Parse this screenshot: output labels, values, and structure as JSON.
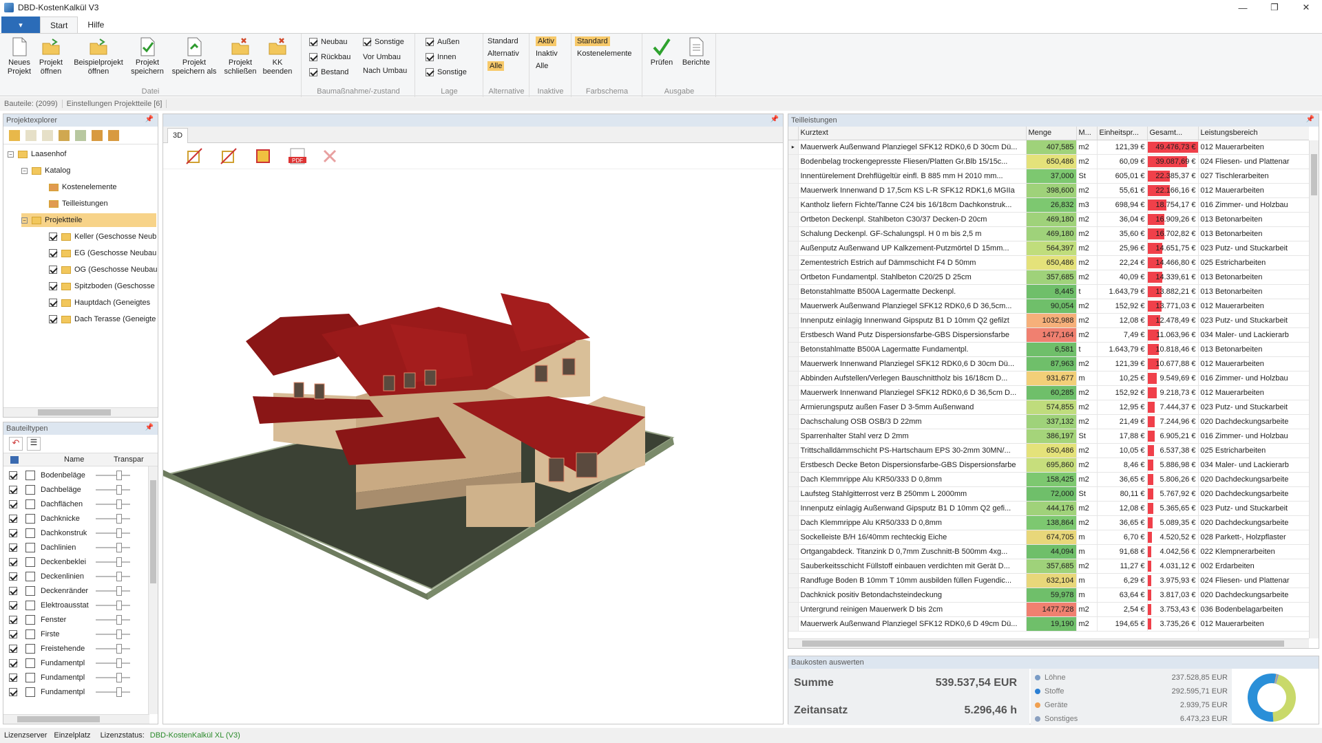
{
  "window": {
    "title": "DBD-KostenKalkül V3"
  },
  "ribbon": {
    "tabs": [
      "Start",
      "Hilfe"
    ],
    "datei": {
      "label": "Datei",
      "buttons": [
        "Neues Projekt",
        "Projekt öffnen",
        "Beispielprojekt öffnen",
        "Projekt speichern",
        "Projekt speichern als",
        "Projekt schließen",
        "KK beenden"
      ]
    },
    "bau": {
      "label": "Baumaßnahme/-zustand",
      "checks": [
        "Neubau",
        "Rückbau",
        "Bestand",
        "Sonstige"
      ],
      "opts": [
        "Vor Umbau",
        "Nach Umbau"
      ]
    },
    "lage": {
      "label": "Lage",
      "checks": [
        "Außen",
        "Innen",
        "Sonstige"
      ]
    },
    "alternative": {
      "label": "Alternative",
      "opts": [
        "Standard",
        "Alternativ",
        "Alle"
      ]
    },
    "inaktive": {
      "label": "Inaktive",
      "opts": [
        "Aktiv",
        "Inaktiv",
        "Alle"
      ]
    },
    "farbschema": {
      "label": "Farbschema",
      "opts": [
        "Standard",
        "Kostenelemente"
      ]
    },
    "ausgabe": {
      "label": "Ausgabe",
      "buttons": [
        "Prüfen",
        "Berichte"
      ]
    }
  },
  "statusbar_top": [
    "Bauteile: (2099)",
    "Einstellungen Projektteile [6]"
  ],
  "explorer": {
    "title": "Projektexplorer",
    "items": [
      "Laasenhof",
      "Katalog",
      "Kostenelemente",
      "Teilleistungen",
      "Projektteile",
      "Keller (Geschosse Neub",
      "EG (Geschosse Neubau",
      "OG (Geschosse Neubau",
      "Spitzboden (Geschosse",
      "Hauptdach (Geneigtes",
      "Dach Terasse (Geneigte"
    ]
  },
  "bauteiltypen": {
    "title": "Bauteiltypen",
    "cols": [
      "Name",
      "Transpar"
    ],
    "items": [
      "Bodenbeläge",
      "Dachbeläge",
      "Dachflächen",
      "Dachknicke",
      "Dachkonstruk",
      "Dachlinien",
      "Deckenbeklei",
      "Deckenlinien",
      "Deckenränder",
      "Elektroausstat",
      "Fenster",
      "Firste",
      "Freistehende",
      "Fundamentpl",
      "Fundamentpl",
      "Fundamentpl"
    ]
  },
  "viewer": {
    "tab": "3D"
  },
  "teilleistungen": {
    "title": "Teilleistungen",
    "cols": [
      "Kurztext",
      "Menge",
      "M...",
      "Einheitspr...",
      "Gesamt...",
      "Leistungsbereich"
    ],
    "rows": [
      [
        "Mauerwerk Außenwand Planziegel SFK12 RDK0,6 D 30cm Dü...",
        "407,585",
        "m2",
        "121,39 €",
        "49.476,73 €",
        "012 Mauerarbeiten"
      ],
      [
        "Bodenbelag trockengepresste Fliesen/Platten Gr.Blb 15/15c...",
        "650,486",
        "m2",
        "60,09 €",
        "39.087,69 €",
        "024 Fliesen- und Plattenar"
      ],
      [
        "Innentürelement Drehflügeltür einfl. B 885 mm H 2010 mm...",
        "37,000",
        "St",
        "605,01 €",
        "22.385,37 €",
        "027 Tischlerarbeiten"
      ],
      [
        "Mauerwerk Innenwand D 17,5cm KS L-R SFK12 RDK1,6 MGIIa",
        "398,600",
        "m2",
        "55,61 €",
        "22.166,16 €",
        "012 Mauerarbeiten"
      ],
      [
        "Kantholz liefern Fichte/Tanne C24 bis 16/18cm Dachkonstruk...",
        "26,832",
        "m3",
        "698,94 €",
        "18.754,17 €",
        "016 Zimmer- und Holzbau"
      ],
      [
        "Ortbeton Deckenpl. Stahlbeton C30/37 Decken-D 20cm",
        "469,180",
        "m2",
        "36,04 €",
        "16.909,26 €",
        "013 Betonarbeiten"
      ],
      [
        "Schalung Deckenpl. GF-Schalungspl. H 0 m bis 2,5 m",
        "469,180",
        "m2",
        "35,60 €",
        "16.702,82 €",
        "013 Betonarbeiten"
      ],
      [
        "Außenputz Außenwand UP Kalkzement-Putzmörtel D 15mm...",
        "564,397",
        "m2",
        "25,96 €",
        "14.651,75 €",
        "023 Putz- und Stuckarbeit"
      ],
      [
        "Zementestrich Estrich auf Dämmschicht F4 D 50mm",
        "650,486",
        "m2",
        "22,24 €",
        "14.466,80 €",
        "025 Estricharbeiten"
      ],
      [
        "Ortbeton Fundamentpl. Stahlbeton C20/25 D 25cm",
        "357,685",
        "m2",
        "40,09 €",
        "14.339,61 €",
        "013 Betonarbeiten"
      ],
      [
        "Betonstahlmatte B500A Lagermatte Deckenpl.",
        "8,445",
        "t",
        "1.643,79 €",
        "13.882,21 €",
        "013 Betonarbeiten"
      ],
      [
        "Mauerwerk Außenwand Planziegel SFK12 RDK0,6 D 36,5cm...",
        "90,054",
        "m2",
        "152,92 €",
        "13.771,03 €",
        "012 Mauerarbeiten"
      ],
      [
        "Innenputz einlagig Innenwand Gipsputz B1 D 10mm Q2 gefilzt",
        "1032,988",
        "m2",
        "12,08 €",
        "12.478,49 €",
        "023 Putz- und Stuckarbeit"
      ],
      [
        "Erstbesch Wand Putz Dispersionsfarbe-GBS Dispersionsfarbe",
        "1477,164",
        "m2",
        "7,49 €",
        "11.063,96 €",
        "034 Maler- und Lackierarb"
      ],
      [
        "Betonstahlmatte B500A Lagermatte Fundamentpl.",
        "6,581",
        "t",
        "1.643,79 €",
        "10.818,46 €",
        "013 Betonarbeiten"
      ],
      [
        "Mauerwerk Innenwand Planziegel SFK12 RDK0,6 D 30cm Dü...",
        "87,963",
        "m2",
        "121,39 €",
        "10.677,88 €",
        "012 Mauerarbeiten"
      ],
      [
        "Abbinden Aufstellen/Verlegen Bauschnittholz bis 16/18cm D...",
        "931,677",
        "m",
        "10,25 €",
        "9.549,69 €",
        "016 Zimmer- und Holzbau"
      ],
      [
        "Mauerwerk Innenwand Planziegel SFK12 RDK0,6 D 36,5cm D...",
        "60,285",
        "m2",
        "152,92 €",
        "9.218,73 €",
        "012 Mauerarbeiten"
      ],
      [
        "Armierungsputz außen Faser D 3-5mm Außenwand",
        "574,855",
        "m2",
        "12,95 €",
        "7.444,37 €",
        "023 Putz- und Stuckarbeit"
      ],
      [
        "Dachschalung OSB OSB/3 D 22mm",
        "337,132",
        "m2",
        "21,49 €",
        "7.244,96 €",
        "020 Dachdeckungsarbeite"
      ],
      [
        "Sparrenhalter Stahl verz D 2mm",
        "386,197",
        "St",
        "17,88 €",
        "6.905,21 €",
        "016 Zimmer- und Holzbau"
      ],
      [
        "Trittschalldämmschicht PS-Hartschaum EPS 30-2mm 30MN/...",
        "650,486",
        "m2",
        "10,05 €",
        "6.537,38 €",
        "025 Estricharbeiten"
      ],
      [
        "Erstbesch Decke Beton Dispersionsfarbe-GBS Dispersionsfarbe",
        "695,860",
        "m2",
        "8,46 €",
        "5.886,98 €",
        "034 Maler- und Lackierarb"
      ],
      [
        "Dach Klemmrippe Alu KR50/333 D 0,8mm",
        "158,425",
        "m2",
        "36,65 €",
        "5.806,26 €",
        "020 Dachdeckungsarbeite"
      ],
      [
        "Laufsteg Stahlgitterrost verz B 250mm L 2000mm",
        "72,000",
        "St",
        "80,11 €",
        "5.767,92 €",
        "020 Dachdeckungsarbeite"
      ],
      [
        "Innenputz einlagig Außenwand Gipsputz B1 D 10mm Q2 gefi...",
        "444,176",
        "m2",
        "12,08 €",
        "5.365,65 €",
        "023 Putz- und Stuckarbeit"
      ],
      [
        "Dach Klemmrippe Alu KR50/333 D 0,8mm",
        "138,864",
        "m2",
        "36,65 €",
        "5.089,35 €",
        "020 Dachdeckungsarbeite"
      ],
      [
        "Sockelleiste B/H 16/40mm rechteckig Eiche",
        "674,705",
        "m",
        "6,70 €",
        "4.520,52 €",
        "028 Parkett-, Holzpflaster"
      ],
      [
        "Ortgangabdeck. Titanzink D 0,7mm Zuschnitt-B 500mm 4xg...",
        "44,094",
        "m",
        "91,68 €",
        "4.042,56 €",
        "022 Klempnerarbeiten"
      ],
      [
        "Sauberkeitsschicht Füllstoff einbauen verdichten mit Gerät D...",
        "357,685",
        "m2",
        "11,27 €",
        "4.031,12 €",
        "002 Erdarbeiten"
      ],
      [
        "Randfuge Boden B 10mm T 10mm ausbilden füllen Fugendic...",
        "632,104",
        "m",
        "6,29 €",
        "3.975,93 €",
        "024 Fliesen- und Plattenar"
      ],
      [
        "Dachknick positiv Betondachsteindeckung",
        "59,978",
        "m",
        "63,64 €",
        "3.817,03 €",
        "020 Dachdeckungsarbeite"
      ],
      [
        "Untergrund reinigen Mauerwerk D bis 2cm",
        "1477,728",
        "m2",
        "2,54 €",
        "3.753,43 €",
        "036 Bodenbelagarbeiten"
      ],
      [
        "Mauerwerk Außenwand Planziegel SFK12 RDK0,6 D 49cm Dü...",
        "19,190",
        "m2",
        "194,65 €",
        "3.735,26 €",
        "012 Mauerarbeiten"
      ]
    ],
    "menge_colors": [
      "#9fd27a",
      "#e4e27a",
      "#7dc870",
      "#9fd27a",
      "#7dc870",
      "#9fd27a",
      "#9fd27a",
      "#c0dd7c",
      "#e4e27a",
      "#9fd27a",
      "#6fbf6a",
      "#6fbf6a",
      "#f6b07a",
      "#f08070",
      "#6fbf6a",
      "#6fbf6a",
      "#f2cf78",
      "#6fbf6a",
      "#bfdc7c",
      "#9fd27a",
      "#a5d47a",
      "#e4e27a",
      "#c7de7c",
      "#7dc870",
      "#6fbf6a",
      "#a0d27a",
      "#7dc870",
      "#e8d77a",
      "#6fbf6a",
      "#9fd27a",
      "#e8d77a",
      "#6fbf6a",
      "#f08070",
      "#6fbf6a"
    ],
    "gesamt_fraction": [
      1.0,
      0.79,
      0.45,
      0.45,
      0.38,
      0.34,
      0.34,
      0.3,
      0.29,
      0.29,
      0.28,
      0.28,
      0.25,
      0.22,
      0.22,
      0.22,
      0.19,
      0.19,
      0.15,
      0.15,
      0.14,
      0.13,
      0.12,
      0.12,
      0.12,
      0.11,
      0.1,
      0.09,
      0.08,
      0.08,
      0.08,
      0.08,
      0.08,
      0.08
    ]
  },
  "baukosten": {
    "title": "Baukosten auswerten",
    "summe_label": "Summe",
    "summe": "539.537,54 EUR",
    "zeit_label": "Zeitansatz",
    "zeit": "5.296,46 h",
    "legend": [
      {
        "name": "Löhne",
        "value": "237.528,85 EUR",
        "color": "#7a9cc6"
      },
      {
        "name": "Stoffe",
        "value": "292.595,71 EUR",
        "color": "#2a7fd4"
      },
      {
        "name": "Geräte",
        "value": "2.939,75 EUR",
        "color": "#f0a050"
      },
      {
        "name": "Sonstiges",
        "value": "6.473,23 EUR",
        "color": "#8aa0c0"
      }
    ],
    "donut_fractions": [
      0.44,
      0.54,
      0.005,
      0.012
    ],
    "donut_colors": [
      "#c9d96a",
      "#2a8fd8",
      "#f0a050",
      "#8aa0c0"
    ]
  },
  "bottom": {
    "lizenzserver": "Lizenzserver",
    "einzelplatz": "Einzelplatz",
    "status_label": "Lizenzstatus:",
    "status_value": "DBD-KostenKalkül XL (V3)"
  }
}
